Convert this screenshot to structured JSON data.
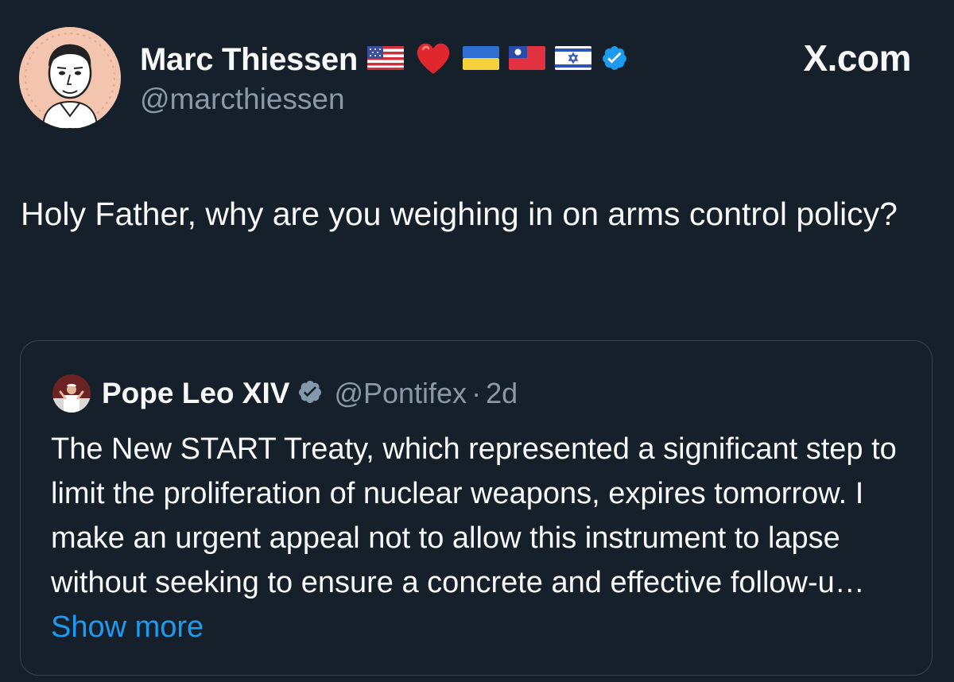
{
  "author": {
    "name": "Marc Thiessen",
    "handle": "@marcthiessen",
    "verified": true
  },
  "brand": {
    "label": "X.com"
  },
  "tweet": {
    "text": "Holy Father, why are you weighing in on arms control policy?"
  },
  "quote": {
    "name": "Pope Leo XIV",
    "handle": "@Pontifex",
    "separator": "·",
    "time": "2d",
    "text": "The New START Treaty, which represented a significant step to limit the proliferation of nuclear weapons, expires tomorrow. I make an urgent appeal not to allow this instrument to lapse without seeking to ensure a concrete and effective follow-u… ",
    "show_more": "Show more"
  },
  "icons": {
    "author_badges": [
      "us-flag-icon",
      "red-heart-icon",
      "ukraine-flag-icon",
      "taiwan-flag-icon",
      "israel-flag-icon",
      "verified-badge-icon"
    ],
    "quote_badge": "gray-verified-badge-icon"
  },
  "colors": {
    "background": "#15202b",
    "text": "#f7f9f9",
    "muted": "#8b98a5",
    "link": "#1d9bf0",
    "verified": "#1d9bf0",
    "border": "#38444d"
  }
}
